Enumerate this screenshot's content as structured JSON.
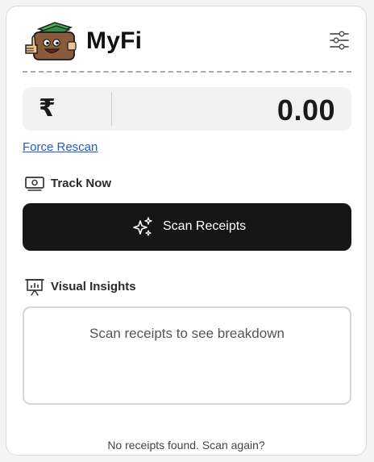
{
  "app": {
    "title": "MyFi"
  },
  "balance": {
    "currency_symbol": "₹",
    "amount": "0.00"
  },
  "links": {
    "force_rescan": "Force Rescan"
  },
  "track": {
    "heading": "Track Now",
    "icon": "cash-icon",
    "scan_button_label": "Scan Receipts",
    "scan_button_icon": "sparkles-icon"
  },
  "insights": {
    "heading": "Visual Insights",
    "icon": "presentation-chart-icon",
    "empty_message": "Scan receipts to see breakdown"
  },
  "footer": {
    "message": "No receipts found. Scan again?"
  },
  "colors": {
    "button_bg": "#161616",
    "link": "#1f5fbf",
    "logo_money": "#3aa655",
    "logo_face": "#8a5a3c"
  }
}
